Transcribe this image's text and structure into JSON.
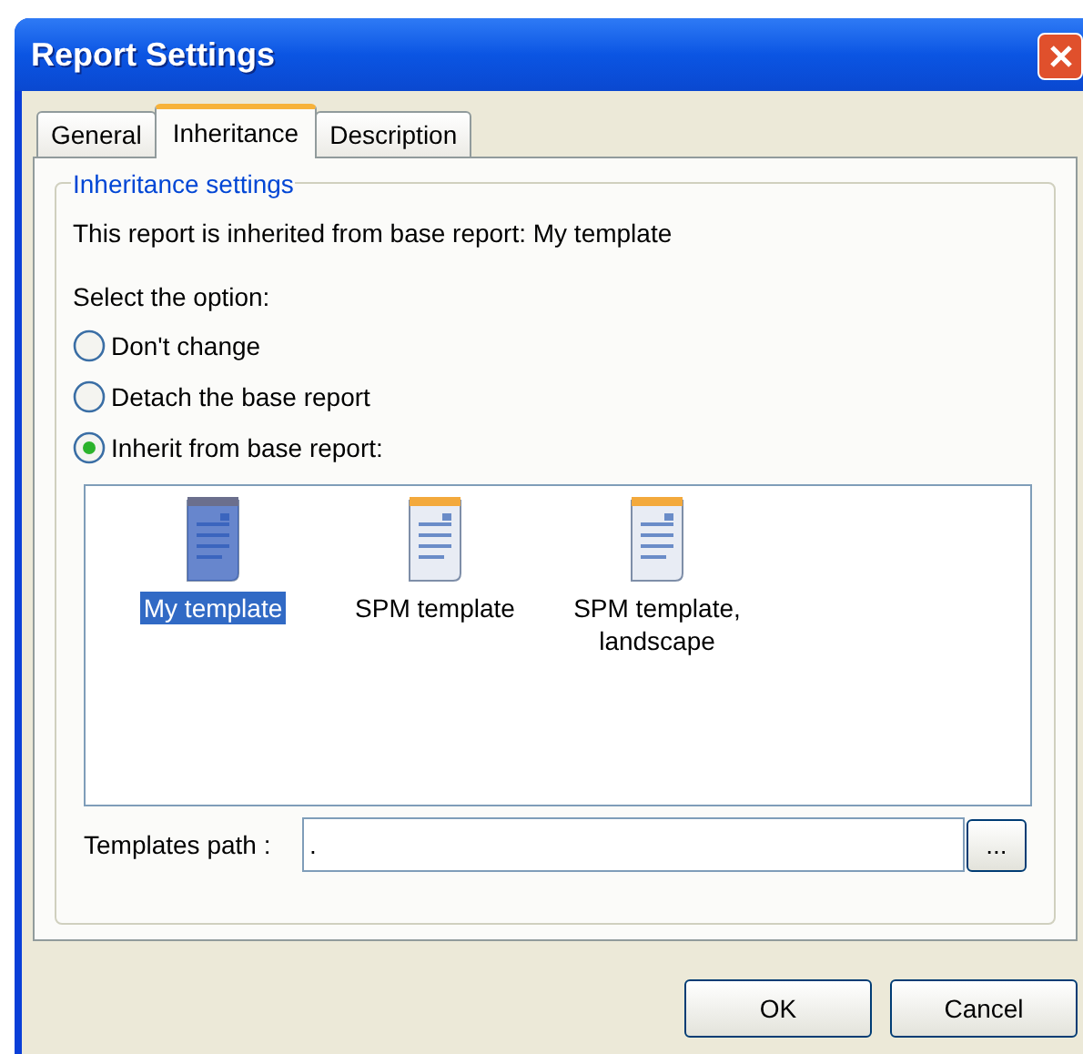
{
  "window": {
    "title": "Report Settings"
  },
  "tabs": [
    {
      "label": "General",
      "selected": false
    },
    {
      "label": "Inheritance",
      "selected": true
    },
    {
      "label": "Description",
      "selected": false
    }
  ],
  "group": {
    "legend": "Inheritance settings"
  },
  "info": "This report is inherited from base report: My template",
  "prompt": "Select the option:",
  "options": [
    {
      "label": "Don't change",
      "selected": false
    },
    {
      "label": "Detach the base report",
      "selected": false
    },
    {
      "label": "Inherit from base report:",
      "selected": true
    }
  ],
  "templates": [
    {
      "label": "My template",
      "selected": true
    },
    {
      "label": "SPM template",
      "selected": false
    },
    {
      "label": "SPM template, landscape",
      "selected": false
    }
  ],
  "path": {
    "label": "Templates path :",
    "value": ".",
    "browse": "..."
  },
  "buttons": [
    "OK",
    "Cancel"
  ]
}
